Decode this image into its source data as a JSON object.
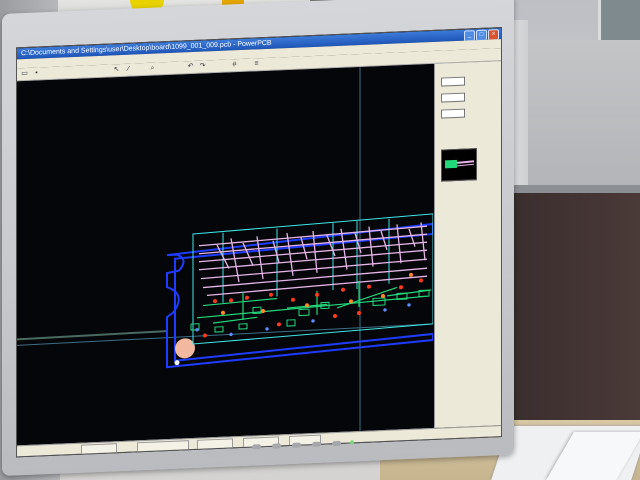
{
  "app": {
    "title": "C:\\Documents and Settings\\user\\Desktop\\board\\1099_001_009.pcb - PowerPCB",
    "menu_items": [],
    "status_fields": [
      "",
      "",
      "",
      "",
      ""
    ]
  },
  "colors": {
    "board_outline": "#1e3cff",
    "trace_pink": "#e6b4e6",
    "trace_green": "#22d97a",
    "cyan_outline": "#3fe6e6",
    "via_red": "#ff3a1a",
    "via_orange": "#ff8a2a",
    "pad_cream": "#f2b8a0"
  },
  "icons": {
    "window_controls": [
      "minimize-icon",
      "maximize-icon",
      "close-icon"
    ],
    "toolbar": [
      "open-icon",
      "save-icon",
      "select-icon",
      "route-icon",
      "zoom-icon",
      "undo-icon",
      "redo-icon",
      "grid-icon",
      "layer-icon"
    ]
  }
}
